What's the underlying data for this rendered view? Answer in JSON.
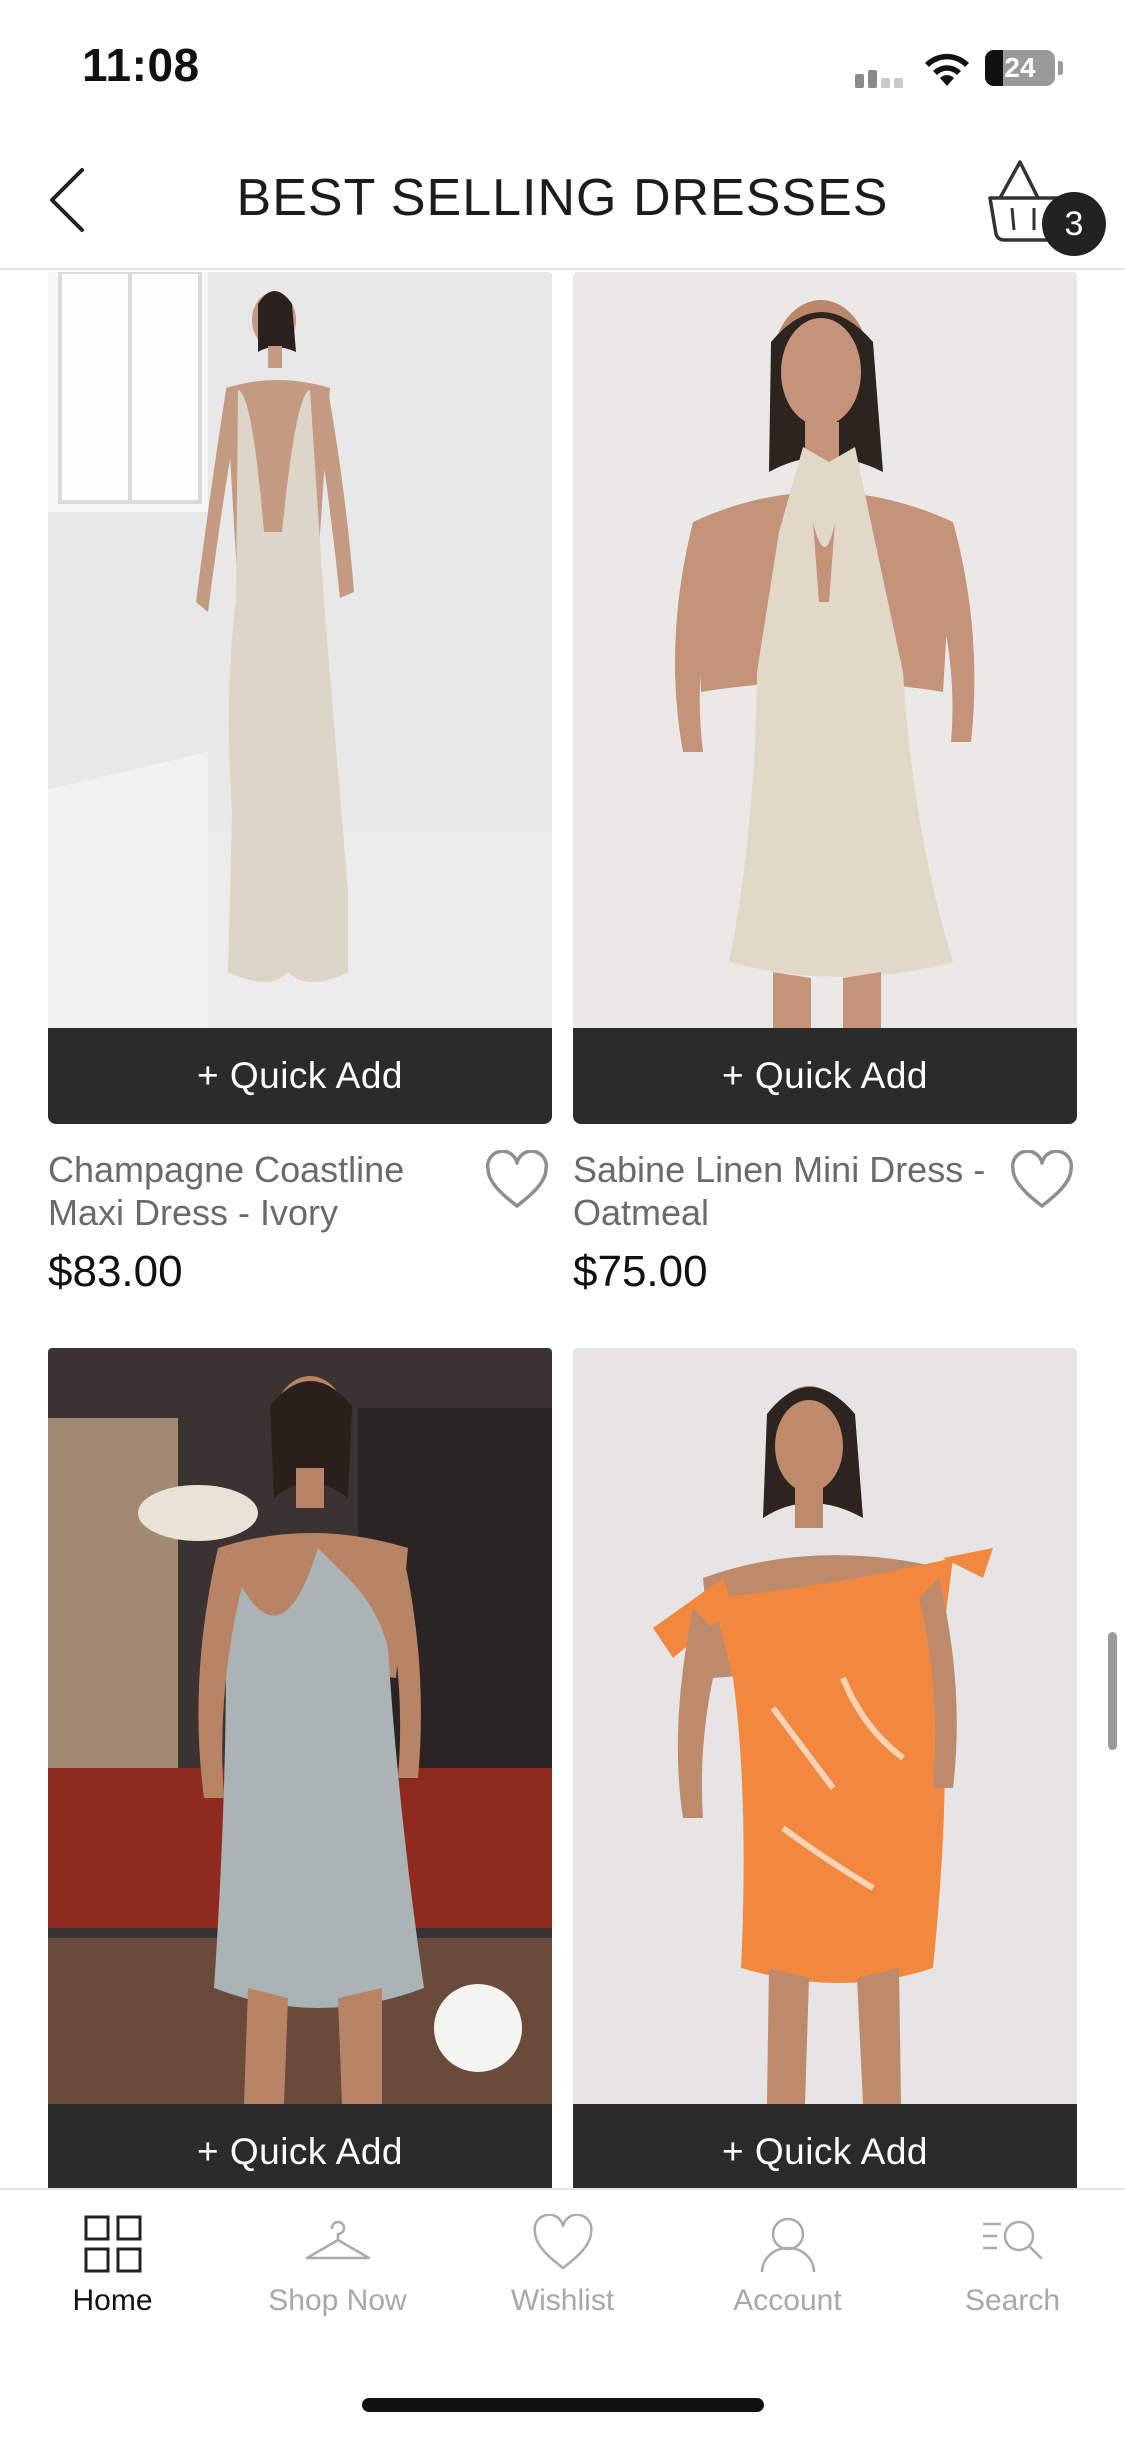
{
  "status": {
    "time": "11:08",
    "battery": "24"
  },
  "header": {
    "title": "BEST SELLING DRESSES",
    "cart_count": "3"
  },
  "products": [
    {
      "name": "Champagne Coastline Maxi Dress - Ivory",
      "price": "$83.00",
      "quick_add": "+ Quick Add",
      "dress_color": "#ddd5c8"
    },
    {
      "name": "Sabine Linen Mini Dress - Oatmeal",
      "price": "$75.00",
      "quick_add": "+ Quick Add",
      "dress_color": "#e2d8c8"
    },
    {
      "name": "",
      "price": "",
      "quick_add": "+ Quick Add",
      "dress_color": "#aab3b5"
    },
    {
      "name": "",
      "price": "",
      "quick_add": "+ Quick Add",
      "dress_color": "#f2883f"
    }
  ],
  "tabs": [
    {
      "label": "Home",
      "icon": "grid-icon",
      "active": true
    },
    {
      "label": "Shop Now",
      "icon": "hanger-icon",
      "active": false
    },
    {
      "label": "Wishlist",
      "icon": "heart-icon",
      "active": false
    },
    {
      "label": "Account",
      "icon": "person-icon",
      "active": false
    },
    {
      "label": "Search",
      "icon": "search-list-icon",
      "active": false
    }
  ],
  "colors": {
    "quick_add_bg": "#2b2b2b",
    "tab_inactive": "#a8a8a8",
    "tab_active": "#111111"
  }
}
